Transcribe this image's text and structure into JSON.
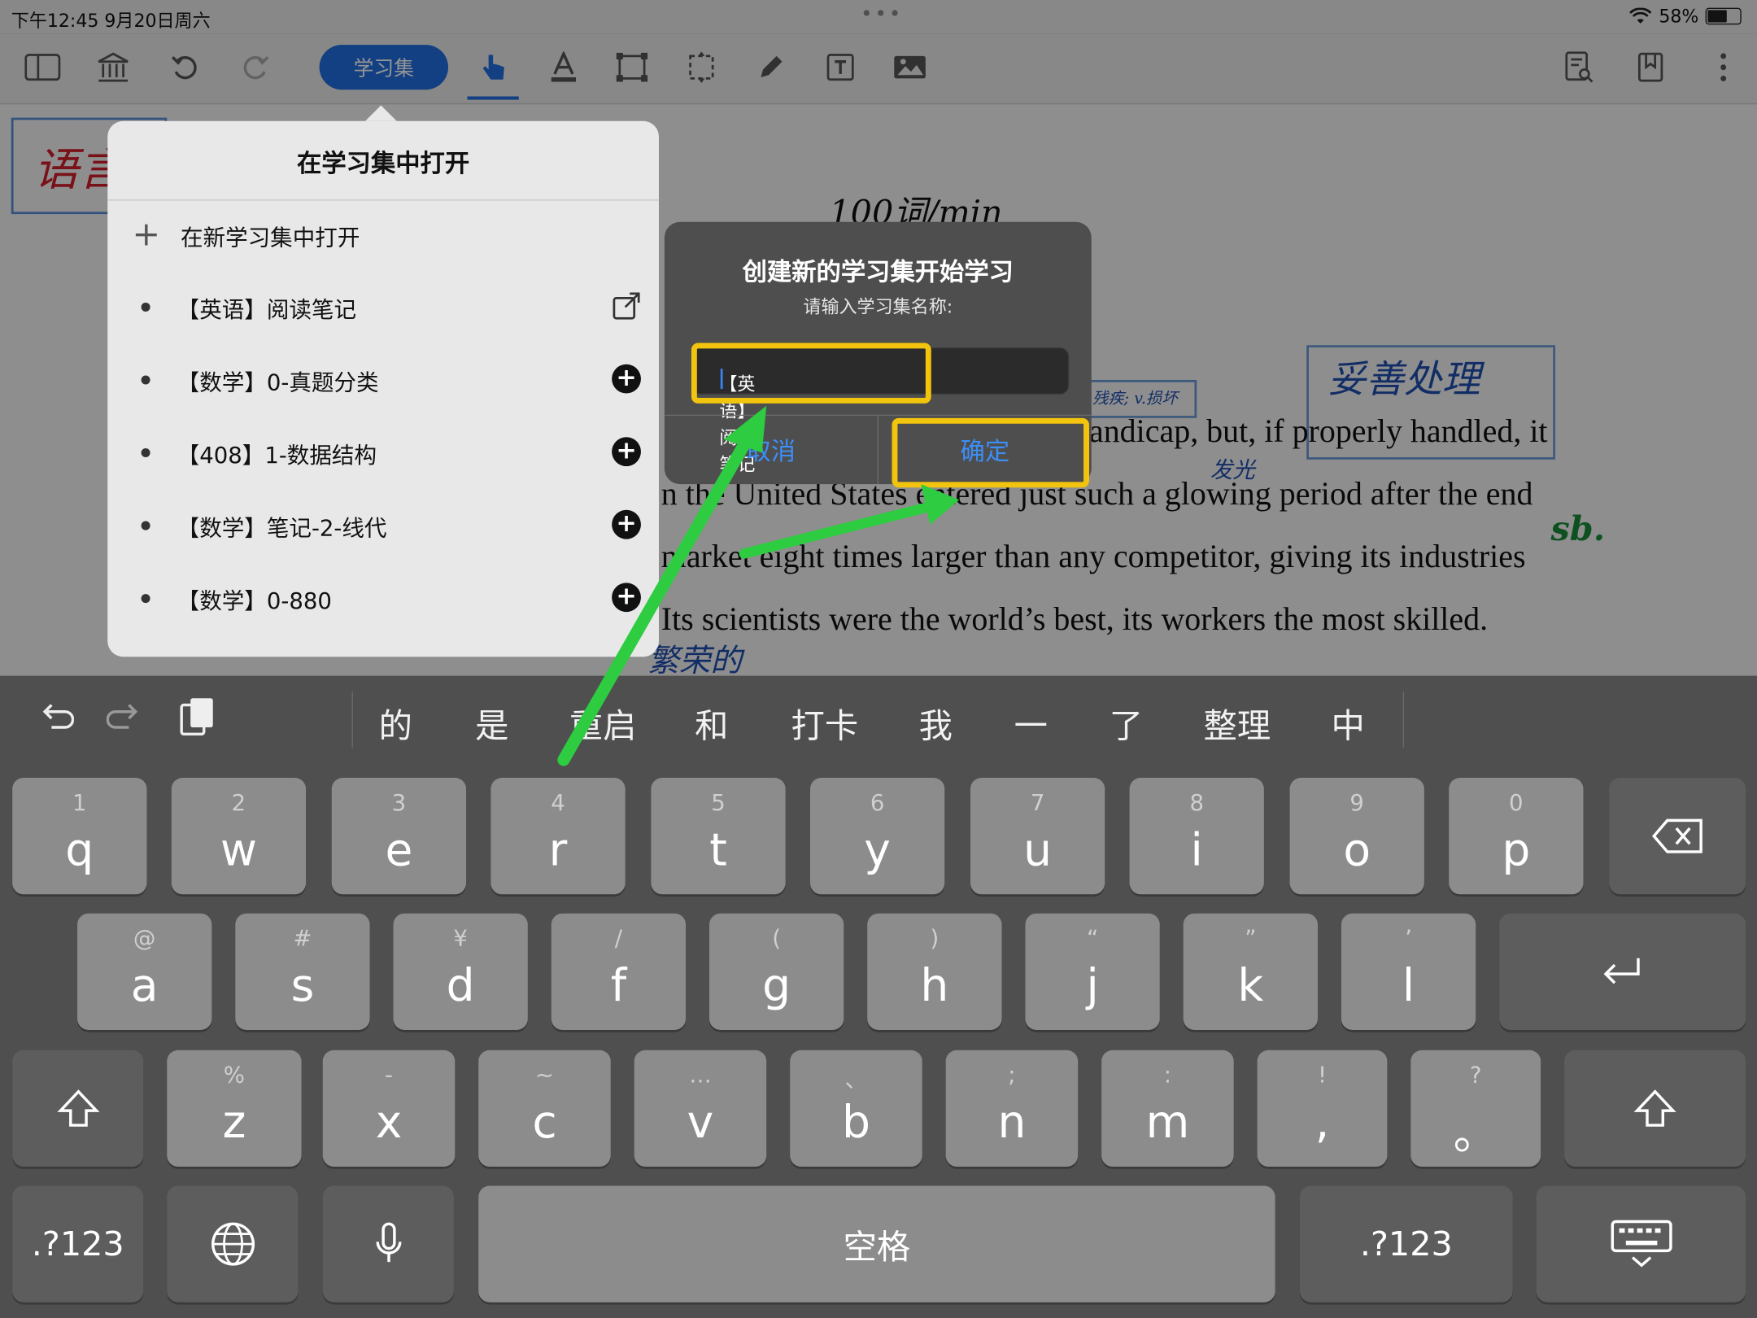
{
  "status_bar": {
    "time": "下午12:45  9月20日周六",
    "battery": "58%"
  },
  "toolbar": {
    "study_set_label": "学习集"
  },
  "document": {
    "lines": [
      "andicap, but, if properly handled, it",
      "n the United States entered just such a glowing period after the end",
      "market eight times larger than any competitor, giving its industries",
      "Its scientists were the world’s best, its workers the most skilled."
    ],
    "annotations": {
      "speed": "100词/min",
      "sb": "sb.",
      "proper": "妥善处理",
      "glow": "发光",
      "handicap_note": "残疾; v.损坏",
      "flourish": "繁荣的",
      "margin": "语言"
    }
  },
  "popover": {
    "title": "在学习集中打开",
    "new_item": "在新学习集中打开",
    "items": [
      {
        "label": "【英语】阅读笔记"
      },
      {
        "label": "【数学】0-真题分类"
      },
      {
        "label": "【408】1-数据结构"
      },
      {
        "label": "【数学】笔记-2-线代"
      },
      {
        "label": "【数学】0-880"
      }
    ]
  },
  "alert": {
    "title": "创建新的学习集开始学习",
    "message": "请输入学习集名称:",
    "input_value": "【英语】阅读笔记",
    "cancel_label": "取消",
    "confirm_label": "确定"
  },
  "keyboard": {
    "candidates": [
      "的",
      "是",
      "重启",
      "和",
      "打卡",
      "我",
      "一",
      "了",
      "整理",
      "中"
    ],
    "row1": [
      {
        "hint": "1",
        "key": "q"
      },
      {
        "hint": "2",
        "key": "w"
      },
      {
        "hint": "3",
        "key": "e"
      },
      {
        "hint": "4",
        "key": "r"
      },
      {
        "hint": "5",
        "key": "t"
      },
      {
        "hint": "6",
        "key": "y"
      },
      {
        "hint": "7",
        "key": "u"
      },
      {
        "hint": "8",
        "key": "i"
      },
      {
        "hint": "9",
        "key": "o"
      },
      {
        "hint": "0",
        "key": "p"
      }
    ],
    "row2": [
      {
        "hint": "@",
        "key": "a"
      },
      {
        "hint": "#",
        "key": "s"
      },
      {
        "hint": "¥",
        "key": "d"
      },
      {
        "hint": "/",
        "key": "f"
      },
      {
        "hint": "(",
        "key": "g"
      },
      {
        "hint": ")",
        "key": "h"
      },
      {
        "hint": "“",
        "key": "j"
      },
      {
        "hint": "”",
        "key": "k"
      },
      {
        "hint": "’",
        "key": "l"
      }
    ],
    "row3": [
      {
        "hint": "%",
        "key": "z"
      },
      {
        "hint": "-",
        "key": "x"
      },
      {
        "hint": "~",
        "key": "c"
      },
      {
        "hint": "…",
        "key": "v"
      },
      {
        "hint": "、",
        "key": "b"
      },
      {
        "hint": ";",
        "key": "n"
      },
      {
        "hint": ":",
        "key": "m"
      },
      {
        "hint": "!",
        "key": ","
      },
      {
        "hint": "?",
        "key": "。"
      }
    ],
    "num_label": ".?123",
    "space_label": "空格"
  },
  "colors": {
    "accent": "#1f6fe0",
    "highlight": "#f3c40d",
    "arrow": "#2ecc40"
  }
}
